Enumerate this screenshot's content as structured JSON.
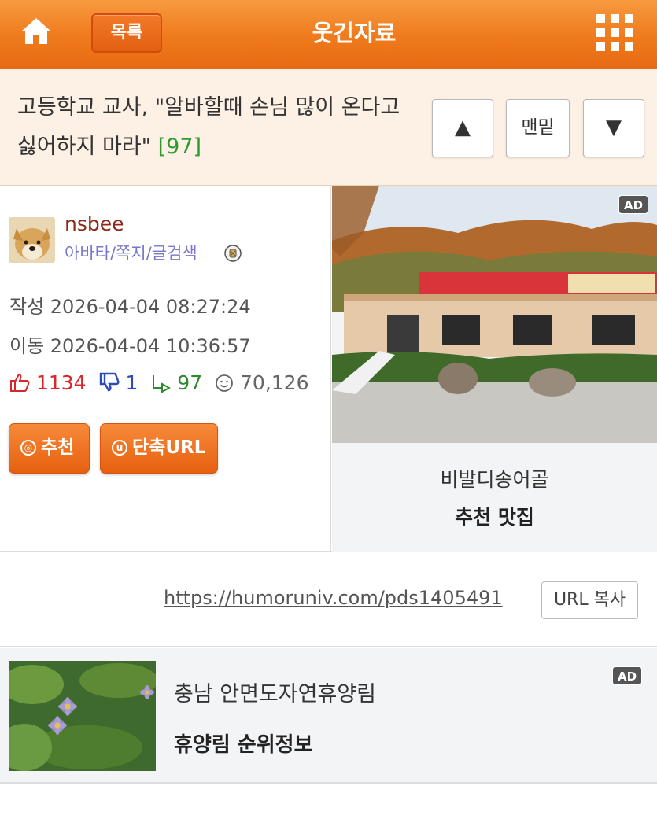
{
  "header": {
    "list_label": "목록",
    "title": "웃긴자료",
    "home_icon": "home-icon",
    "menu_icon": "grid-menu-icon"
  },
  "post": {
    "title": "고등학교 교사, \"알바할때 손님 많이 온다고 싫어하지 마라\"",
    "reply_count": "[97]",
    "nav": {
      "up": "▲",
      "bottom": "맨밑",
      "down": "▼"
    }
  },
  "author": {
    "name": "nsbee",
    "links": "아바타/쪽지/글검색"
  },
  "meta": {
    "written": "작성 2026-04-04 08:27:24",
    "moved": "이동 2026-04-04 10:36:57"
  },
  "stats": {
    "up": "1134",
    "down": "1",
    "replies": "97",
    "views": "70,126"
  },
  "actions": {
    "recommend": "추천",
    "short_url": "단축URL"
  },
  "ad_top": {
    "badge": "AD",
    "name": "비발디송어골",
    "desc": "추천 맛집"
  },
  "url": {
    "link": "https://humoruniv.com/pds1405491",
    "copy_label": "URL 복사"
  },
  "ad_bottom": {
    "badge": "AD",
    "name": "충남 안면도자연휴양림",
    "desc": "휴양림 순위정보"
  },
  "colors": {
    "header_orange": "#ef7a1c",
    "title_bg": "#fdf1e6",
    "reply_green": "#2f9a2f",
    "up_red": "#d8262e",
    "down_blue": "#2a4bb8",
    "author_brown": "#8b2a1a",
    "link_purple": "#7777cc"
  }
}
